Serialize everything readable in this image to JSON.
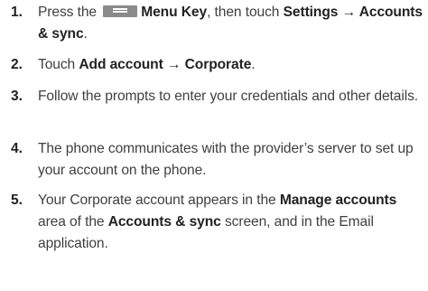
{
  "steps": [
    {
      "number": "1.",
      "parts": {
        "t1": "Press the",
        "icon": "menu-key-icon",
        "b1": "Menu Key",
        "t2": ", then touch",
        "b2": "Settings → Accounts & sync",
        "t3": "."
      }
    },
    {
      "number": "2.",
      "parts": {
        "t1": "Touch",
        "b1": "Add account → Corporate",
        "t2": "."
      }
    },
    {
      "number": "3.",
      "text": "Follow the prompts to enter your credentials and other details."
    },
    {
      "number": "4.",
      "text": "The phone communicates with the provider’s server to set up your account on the phone."
    },
    {
      "number": "5.",
      "parts": {
        "t1": "Your Corporate account appears in the",
        "b1": "Manage accounts",
        "t2": "area of the",
        "b2": "Accounts & sync",
        "t3": "screen, and in the Email application."
      }
    }
  ]
}
